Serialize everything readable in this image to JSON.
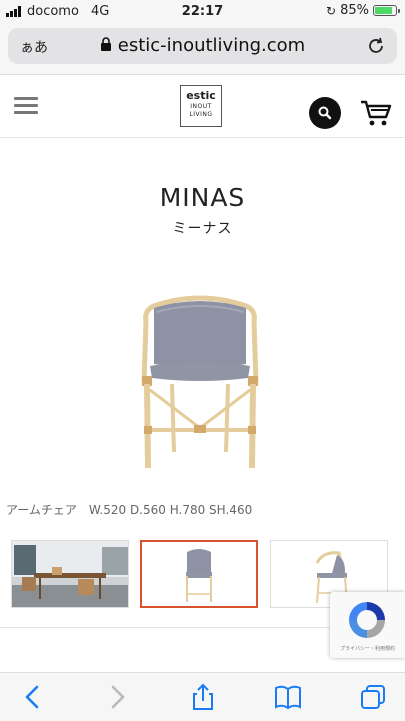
{
  "status_bar": {
    "carrier": "docomo",
    "network": "4G",
    "time": "22:17",
    "battery_percent": "85%",
    "battery_level": 0.85
  },
  "browser": {
    "aa_label": "ぁあ",
    "url": "estic-inoutliving.com"
  },
  "site_header": {
    "logo_line1": "estic",
    "logo_line2": "INOUT",
    "logo_line3": "LIVING"
  },
  "product": {
    "name": "MINAS",
    "name_kana": "ミーナス",
    "spec": "アームチェア　W.520 D.560 H.780 SH.460"
  },
  "recaptcha": {
    "label": "プライバシー・利用規約"
  },
  "colors": {
    "accent": "#d9532e",
    "cushion": "#8e92a4",
    "rattan": "#e4cc9c",
    "ios_blue": "#1a7cf5"
  }
}
